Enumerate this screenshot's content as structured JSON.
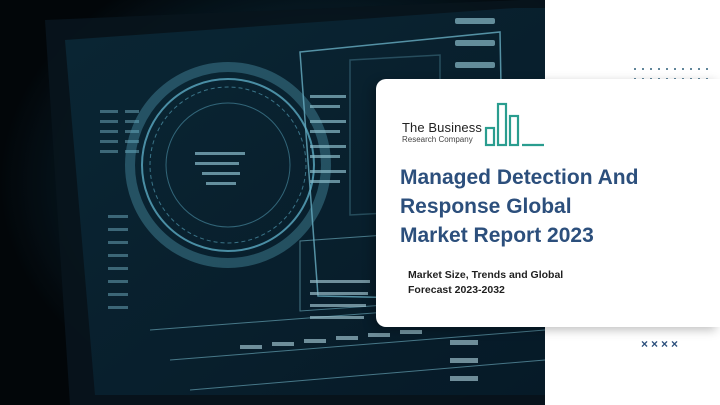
{
  "logo": {
    "name": "The Business",
    "sub": "Research Company"
  },
  "report": {
    "title_lines": [
      "Managed Detection And",
      "Response Global",
      "Market Report 2023"
    ],
    "subtitle_lines": [
      "Market Size, Trends and Global",
      "Forecast 2023-2032"
    ]
  },
  "decor": {
    "marks": "××××"
  },
  "colors": {
    "title": "#2c4f7c",
    "logo_bars": "#2a9d8f",
    "hero_bg": "#06121a",
    "hero_glow": "#3fb6d6"
  }
}
